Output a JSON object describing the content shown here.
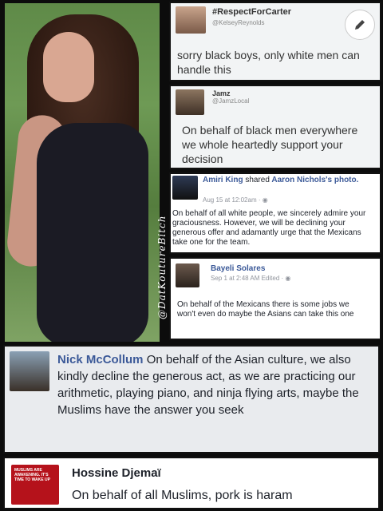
{
  "photo": {
    "watermark": "@DatKoutureBitch"
  },
  "tweet1": {
    "name": "#RespectForCarter",
    "handle": "@KelseyReynolds",
    "text": "sorry black boys, only white men can handle this",
    "edit_icon": "pencil-icon"
  },
  "tweet2": {
    "name": "Jamz",
    "handle": "@JamzLocal",
    "text": "On behalf of black men everywhere we whole heartedly support your decision"
  },
  "post1": {
    "author": "Amiri King",
    "action": "shared",
    "target": "Aaron Nichols's photo.",
    "meta": "Aug 15 at 12:02am · ",
    "text": "On behalf of all white people, we sincerely admire your graciousness. However, we will be declining your generous offer and adamantly urge that the Mexicans take one for the team."
  },
  "post2": {
    "author": "Bayeli Solares",
    "meta": "Sep 1 at 2:48 AM Edited · ",
    "text": "On behalf of the Mexicans there is some jobs we won't even do maybe the Asians can take this one"
  },
  "comment1": {
    "author": "Nick McCollum",
    "text": "On behalf of the Asian culture, we also kindly decline the generous act, as we are practicing our arithmetic, playing piano, and ninja flying arts, maybe the Muslims have the answer you seek"
  },
  "comment2": {
    "author": "Hossine Djemaï",
    "text": "On behalf of all Muslims, pork is haram",
    "avatar_text": "MUSLIMS ARE AWAKENING. IT'S TIME TO WAKE UP"
  }
}
